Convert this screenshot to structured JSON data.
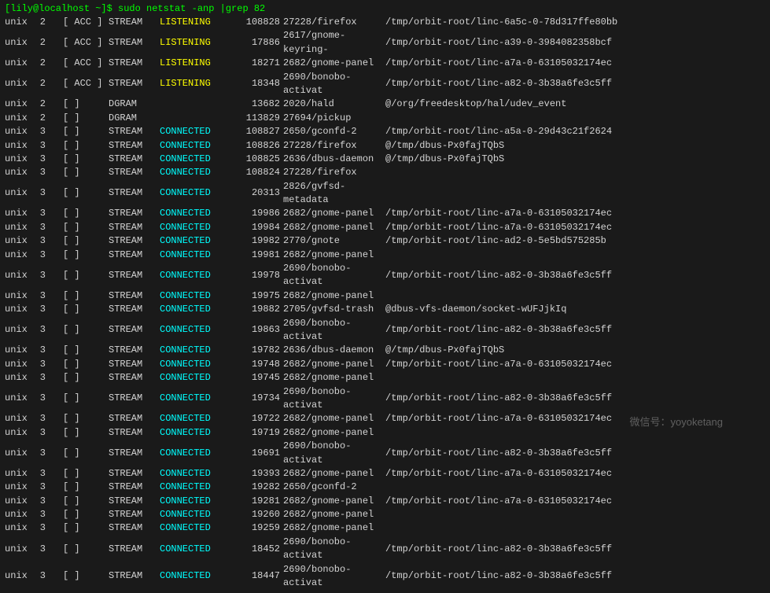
{
  "prompt": "[lily@localhost ~]$ sudo netstat -anp |grep 82",
  "rows": [
    {
      "proto": "unix",
      "recv": "2",
      "send": "",
      "flags": "[ ACC ]",
      "type": "STREAM",
      "state": "LISTENING",
      "inode": "108828",
      "pid": "27228/firefox",
      "path": "/tmp/orbit-root/linc-6a5c-0-78d317ffe80bb"
    },
    {
      "proto": "unix",
      "recv": "2",
      "send": "",
      "flags": "[ ACC ]",
      "type": "STREAM",
      "state": "LISTENING",
      "inode": "17886",
      "pid": "2617/gnome-keyring-",
      "path": "/tmp/orbit-root/linc-a39-0-3984082358bcf"
    },
    {
      "proto": "unix",
      "recv": "2",
      "send": "",
      "flags": "[ ACC ]",
      "type": "STREAM",
      "state": "LISTENING",
      "inode": "18271",
      "pid": "2682/gnome-panel",
      "path": "/tmp/orbit-root/linc-a7a-0-63105032174ec"
    },
    {
      "proto": "unix",
      "recv": "2",
      "send": "",
      "flags": "[ ACC ]",
      "type": "STREAM",
      "state": "LISTENING",
      "inode": "18348",
      "pid": "2690/bonobo-activat",
      "path": "/tmp/orbit-root/linc-a82-0-3b38a6fe3c5ff"
    },
    {
      "proto": "unix",
      "recv": "2",
      "send": "",
      "flags": "[ ]",
      "type": "DGRAM",
      "state": "",
      "inode": "13682",
      "pid": "2020/hald",
      "path": "@/org/freedesktop/hal/udev_event"
    },
    {
      "proto": "unix",
      "recv": "2",
      "send": "",
      "flags": "[ ]",
      "type": "DGRAM",
      "state": "",
      "inode": "113829",
      "pid": "27694/pickup",
      "path": ""
    },
    {
      "proto": "unix",
      "recv": "3",
      "send": "",
      "flags": "[ ]",
      "type": "STREAM",
      "state": "CONNECTED",
      "inode": "108827",
      "pid": "2650/gconfd-2",
      "path": "/tmp/orbit-root/linc-a5a-0-29d43c21f2624"
    },
    {
      "proto": "unix",
      "recv": "3",
      "send": "",
      "flags": "[ ]",
      "type": "STREAM",
      "state": "CONNECTED",
      "inode": "108826",
      "pid": "27228/firefox",
      "path": "@/tmp/dbus-Px0fajTQbS"
    },
    {
      "proto": "unix",
      "recv": "3",
      "send": "",
      "flags": "[ ]",
      "type": "STREAM",
      "state": "CONNECTED",
      "inode": "108825",
      "pid": "2636/dbus-daemon",
      "path": "@/tmp/dbus-Px0fajTQbS"
    },
    {
      "proto": "unix",
      "recv": "3",
      "send": "",
      "flags": "[ ]",
      "type": "STREAM",
      "state": "CONNECTED",
      "inode": "108824",
      "pid": "27228/firefox",
      "path": ""
    },
    {
      "proto": "unix",
      "recv": "3",
      "send": "",
      "flags": "[ ]",
      "type": "STREAM",
      "state": "CONNECTED",
      "inode": "20313",
      "pid": "2826/gvfsd-metadata",
      "path": ""
    },
    {
      "proto": "unix",
      "recv": "3",
      "send": "",
      "flags": "[ ]",
      "type": "STREAM",
      "state": "CONNECTED",
      "inode": "19986",
      "pid": "2682/gnome-panel",
      "path": "/tmp/orbit-root/linc-a7a-0-63105032174ec"
    },
    {
      "proto": "unix",
      "recv": "3",
      "send": "",
      "flags": "[ ]",
      "type": "STREAM",
      "state": "CONNECTED",
      "inode": "19984",
      "pid": "2682/gnome-panel",
      "path": "/tmp/orbit-root/linc-a7a-0-63105032174ec"
    },
    {
      "proto": "unix",
      "recv": "3",
      "send": "",
      "flags": "[ ]",
      "type": "STREAM",
      "state": "CONNECTED",
      "inode": "19982",
      "pid": "2770/gnote",
      "path": "/tmp/orbit-root/linc-ad2-0-5e5bd575285b"
    },
    {
      "proto": "unix",
      "recv": "3",
      "send": "",
      "flags": "[ ]",
      "type": "STREAM",
      "state": "CONNECTED",
      "inode": "19981",
      "pid": "2682/gnome-panel",
      "path": ""
    },
    {
      "proto": "unix",
      "recv": "3",
      "send": "",
      "flags": "[ ]",
      "type": "STREAM",
      "state": "CONNECTED",
      "inode": "19978",
      "pid": "2690/bonobo-activat",
      "path": "/tmp/orbit-root/linc-a82-0-3b38a6fe3c5ff"
    },
    {
      "proto": "unix",
      "recv": "3",
      "send": "",
      "flags": "[ ]",
      "type": "STREAM",
      "state": "CONNECTED",
      "inode": "19975",
      "pid": "2682/gnome-panel",
      "path": ""
    },
    {
      "proto": "unix",
      "recv": "3",
      "send": "",
      "flags": "[ ]",
      "type": "STREAM",
      "state": "CONNECTED",
      "inode": "19882",
      "pid": "2705/gvfsd-trash",
      "path": "@dbus-vfs-daemon/socket-wUFJjkIq"
    },
    {
      "proto": "unix",
      "recv": "3",
      "send": "",
      "flags": "[ ]",
      "type": "STREAM",
      "state": "CONNECTED",
      "inode": "19863",
      "pid": "2690/bonobo-activat",
      "path": "/tmp/orbit-root/linc-a82-0-3b38a6fe3c5ff"
    },
    {
      "proto": "unix",
      "recv": "3",
      "send": "",
      "flags": "[ ]",
      "type": "STREAM",
      "state": "CONNECTED",
      "inode": "19782",
      "pid": "2636/dbus-daemon",
      "path": "@/tmp/dbus-Px0fajTQbS"
    },
    {
      "proto": "unix",
      "recv": "3",
      "send": "",
      "flags": "[ ]",
      "type": "STREAM",
      "state": "CONNECTED",
      "inode": "19748",
      "pid": "2682/gnome-panel",
      "path": "/tmp/orbit-root/linc-a7a-0-63105032174ec"
    },
    {
      "proto": "unix",
      "recv": "3",
      "send": "",
      "flags": "[ ]",
      "type": "STREAM",
      "state": "CONNECTED",
      "inode": "19745",
      "pid": "2682/gnome-panel",
      "path": ""
    },
    {
      "proto": "unix",
      "recv": "3",
      "send": "",
      "flags": "[ ]",
      "type": "STREAM",
      "state": "CONNECTED",
      "inode": "19734",
      "pid": "2690/bonobo-activat",
      "path": "/tmp/orbit-root/linc-a82-0-3b38a6fe3c5ff"
    },
    {
      "proto": "unix",
      "recv": "3",
      "send": "",
      "flags": "[ ]",
      "type": "STREAM",
      "state": "CONNECTED",
      "inode": "19722",
      "pid": "2682/gnome-panel",
      "path": "/tmp/orbit-root/linc-a7a-0-63105032174ec"
    },
    {
      "proto": "unix",
      "recv": "3",
      "send": "",
      "flags": "[ ]",
      "type": "STREAM",
      "state": "CONNECTED",
      "inode": "19719",
      "pid": "2682/gnome-panel",
      "path": ""
    },
    {
      "proto": "unix",
      "recv": "3",
      "send": "",
      "flags": "[ ]",
      "type": "STREAM",
      "state": "CONNECTED",
      "inode": "19691",
      "pid": "2690/bonobo-activat",
      "path": "/tmp/orbit-root/linc-a82-0-3b38a6fe3c5ff"
    },
    {
      "proto": "unix",
      "recv": "3",
      "send": "",
      "flags": "[ ]",
      "type": "STREAM",
      "state": "CONNECTED",
      "inode": "19393",
      "pid": "2682/gnome-panel",
      "path": "/tmp/orbit-root/linc-a7a-0-63105032174ec"
    },
    {
      "proto": "unix",
      "recv": "3",
      "send": "",
      "flags": "[ ]",
      "type": "STREAM",
      "state": "CONNECTED",
      "inode": "19282",
      "pid": "2650/gconfd-2",
      "path": ""
    },
    {
      "proto": "unix",
      "recv": "3",
      "send": "",
      "flags": "[ ]",
      "type": "STREAM",
      "state": "CONNECTED",
      "inode": "19281",
      "pid": "2682/gnome-panel",
      "path": "/tmp/orbit-root/linc-a7a-0-63105032174ec"
    },
    {
      "proto": "unix",
      "recv": "3",
      "send": "",
      "flags": "[ ]",
      "type": "STREAM",
      "state": "CONNECTED",
      "inode": "19260",
      "pid": "2682/gnome-panel",
      "path": ""
    },
    {
      "proto": "unix",
      "recv": "3",
      "send": "",
      "flags": "[ ]",
      "type": "STREAM",
      "state": "CONNECTED",
      "inode": "19259",
      "pid": "2682/gnome-panel",
      "path": ""
    },
    {
      "proto": "unix",
      "recv": "3",
      "send": "",
      "flags": "[ ]",
      "type": "STREAM",
      "state": "CONNECTED",
      "inode": "18452",
      "pid": "2690/bonobo-activat",
      "path": "/tmp/orbit-root/linc-a82-0-3b38a6fe3c5ff"
    },
    {
      "proto": "unix",
      "recv": "3",
      "send": "",
      "flags": "[ ]",
      "type": "STREAM",
      "state": "CONNECTED",
      "inode": "18447",
      "pid": "2690/bonobo-activat",
      "path": "/tmp/orbit-root/linc-a82-0-3b38a6fe3c5ff"
    }
  ],
  "watermark": "微信号：yoyoketang"
}
